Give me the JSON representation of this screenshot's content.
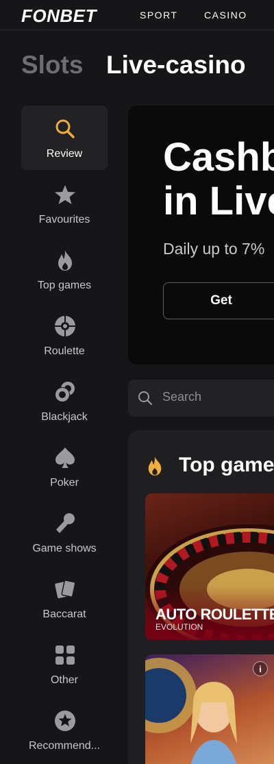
{
  "header": {
    "logo": "FONBET",
    "nav": [
      "SPORT",
      "CASINO"
    ]
  },
  "tabs": {
    "slots": "Slots",
    "live": "Live-casino"
  },
  "sidebar": {
    "items": [
      {
        "label": "Review",
        "icon": "search-icon",
        "active": true
      },
      {
        "label": "Favourites",
        "icon": "star-icon"
      },
      {
        "label": "Top games",
        "icon": "flame-icon"
      },
      {
        "label": "Roulette",
        "icon": "roulette-icon"
      },
      {
        "label": "Blackjack",
        "icon": "chips-icon"
      },
      {
        "label": "Poker",
        "icon": "spade-icon"
      },
      {
        "label": "Game shows",
        "icon": "microphone-icon"
      },
      {
        "label": "Baccarat",
        "icon": "cards-icon"
      },
      {
        "label": "Other",
        "icon": "grid-icon"
      },
      {
        "label": "Recommend...",
        "icon": "star-circle-icon"
      }
    ]
  },
  "banner": {
    "title": "Cashb\nin Live",
    "subtitle": "Daily up to 7%",
    "button": "Get"
  },
  "search": {
    "placeholder": "Search"
  },
  "games": {
    "title": "Top games",
    "cards": [
      {
        "name": "AUTO ROULETTE",
        "provider": "EVOLUTION"
      }
    ]
  },
  "colors": {
    "background": "#161618",
    "accent": "#f0b040",
    "panel": "#1f1f22"
  }
}
